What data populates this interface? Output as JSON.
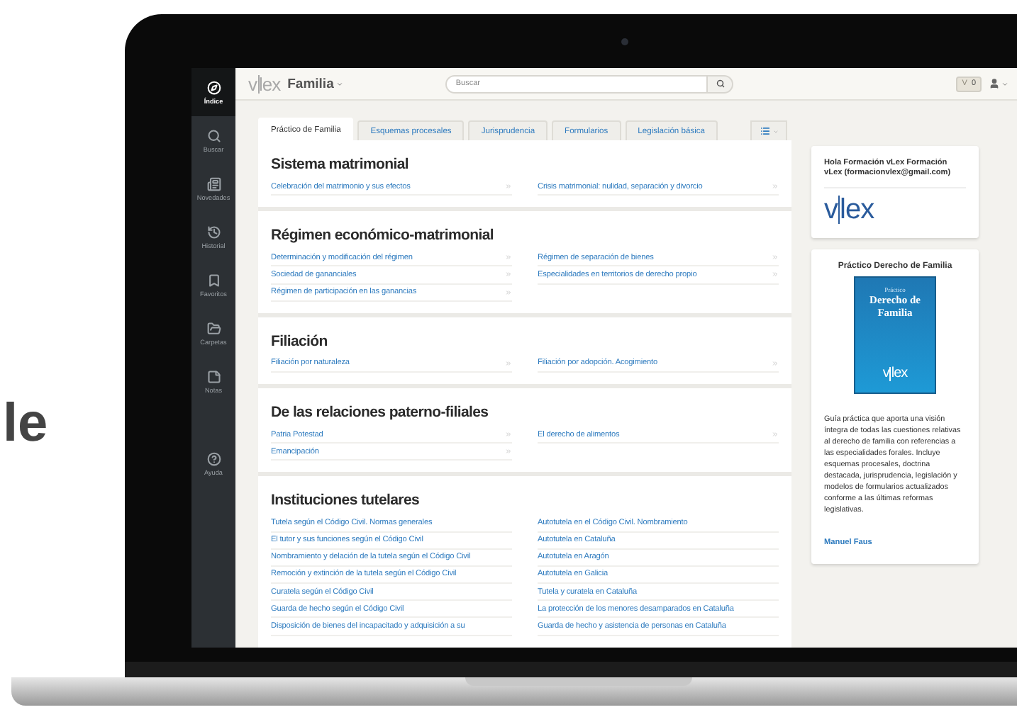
{
  "backdrop_text": "le",
  "sidebar": {
    "items": [
      {
        "label": "Índice",
        "selected": true
      },
      {
        "label": "Buscar",
        "selected": false
      },
      {
        "label": "Novedades",
        "selected": false
      },
      {
        "label": "Historial",
        "selected": false
      },
      {
        "label": "Favoritos",
        "selected": false
      },
      {
        "label": "Carpetas",
        "selected": false
      },
      {
        "label": "Notas",
        "selected": false
      }
    ],
    "help_item": {
      "label": "Ayuda"
    }
  },
  "topbar": {
    "logo": "vlex",
    "section": "Familia",
    "search": {
      "placeholder": "Buscar"
    },
    "badge": {
      "mark": "V",
      "count": "0"
    }
  },
  "tabs": [
    {
      "label": "Práctico de Familia",
      "selected": true
    },
    {
      "label": "Esquemas procesales",
      "selected": false
    },
    {
      "label": "Jurisprudencia",
      "selected": false
    },
    {
      "label": "Formularios",
      "selected": false
    },
    {
      "label": "Legislación básica",
      "selected": false
    }
  ],
  "sections": [
    {
      "title": "Sistema matrimonial",
      "columns": [
        [
          "Celebración del matrimonio y sus efectos"
        ],
        [
          "Crisis matrimonial: nulidad, separación y divorcio"
        ]
      ]
    },
    {
      "title": "Régimen económico-matrimonial",
      "columns": [
        [
          "Determinación y modificación del régimen",
          "Sociedad de gananciales",
          "Régimen de participación en las ganancias"
        ],
        [
          "Régimen de separación de bienes",
          "Especialidades en territorios de derecho propio"
        ]
      ]
    },
    {
      "title": "Filiación",
      "columns": [
        [
          "Filiación por naturaleza"
        ],
        [
          "Filiación por adopción. Acogimiento"
        ]
      ]
    },
    {
      "title": "De las relaciones paterno-filiales",
      "columns": [
        [
          "Patria Potestad",
          "Emancipación"
        ],
        [
          "El derecho de alimentos"
        ]
      ]
    },
    {
      "title": "Instituciones tutelares",
      "columns": [
        [
          "Tutela según el Código Civil. Normas generales",
          "El tutor y sus funciones según el Código Civil",
          "Nombramiento y delación de la tutela según el Código Civil",
          "Remoción y extinción de la tutela según el Código Civil",
          "Curatela según el Código Civil",
          "Guarda de hecho según el Código Civil",
          "Disposición de bienes del incapacitado y adquisición a su"
        ],
        [
          "Autotutela en el Código Civil. Nombramiento",
          "Autotutela en Cataluña",
          "Autotutela en Aragón",
          "Autotutela en Galicia",
          "Tutela y curatela en Cataluña",
          "La protección de los menores desamparados en Cataluña",
          "Guarda de hecho y asistencia de personas en Cataluña"
        ]
      ]
    }
  ],
  "user_card": {
    "greeting": "Hola Formación vLex Formación vLex (formacionvlex@gmail.com)",
    "logo": "vlex"
  },
  "book_card": {
    "title": "Práctico Derecho de Familia",
    "cover": {
      "kicker": "Práctico",
      "title": "Derecho de Familia",
      "logo": "vlex"
    },
    "description": "Guía práctica que aporta una visión íntegra de todas las cuestiones relativas al derecho de familia con referencias a las especialidades forales. Incluye esquemas procesales, doctrina destacada, jurisprudencia, legislación y modelos de formularios actualizados conforme a las últimas reformas legislativas.",
    "author": "Manuel Faus"
  }
}
